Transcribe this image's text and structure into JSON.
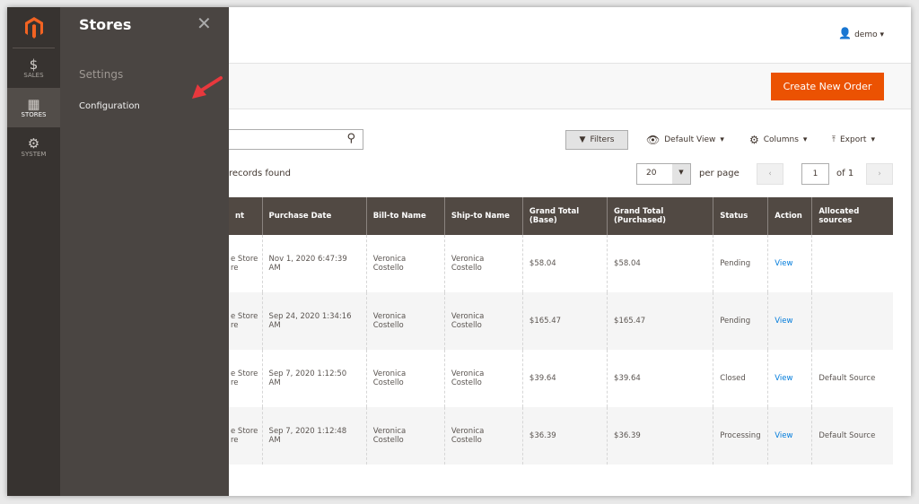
{
  "nav": {
    "items": [
      {
        "label": "SALES",
        "icon": "dollar-icon"
      },
      {
        "label": "STORES",
        "icon": "store-icon",
        "active": true
      },
      {
        "label": "SYSTEM",
        "icon": "gear-icon"
      }
    ]
  },
  "flyout": {
    "title": "Stores",
    "section": "Settings",
    "item": "Configuration"
  },
  "header": {
    "user": "demo"
  },
  "actions": {
    "create": "Create New Order"
  },
  "toolbar": {
    "filters": "Filters",
    "view": "Default View",
    "columns": "Columns",
    "export": "Export"
  },
  "grid": {
    "records": "records found",
    "per_page_value": "20",
    "per_page_label": "per page",
    "page": "1",
    "of": "of 1"
  },
  "table": {
    "headers": [
      "nt",
      "Purchase Date",
      "Bill-to Name",
      "Ship-to Name",
      "Grand Total (Base)",
      "Grand Total (Purchased)",
      "Status",
      "Action",
      "Allocated sources"
    ],
    "rows": [
      [
        "e Store\nre",
        "Nov 1, 2020 6:47:39 AM",
        "Veronica Costello",
        "Veronica Costello",
        "$58.04",
        "$58.04",
        "Pending",
        "View",
        ""
      ],
      [
        "e Store\nre",
        "Sep 24, 2020 1:34:16 AM",
        "Veronica Costello",
        "Veronica Costello",
        "$165.47",
        "$165.47",
        "Pending",
        "View",
        ""
      ],
      [
        "e Store\nre",
        "Sep 7, 2020 1:12:50 AM",
        "Veronica Costello",
        "Veronica Costello",
        "$39.64",
        "$39.64",
        "Closed",
        "View",
        "Default Source"
      ],
      [
        "e Store\nre",
        "Sep 7, 2020 1:12:48 AM",
        "Veronica Costello",
        "Veronica Costello",
        "$36.39",
        "$36.39",
        "Processing",
        "View",
        "Default Source"
      ]
    ]
  },
  "colors": {
    "accent": "#eb5202",
    "nav": "#373330",
    "flyout": "#4a4542",
    "header": "#514943"
  }
}
